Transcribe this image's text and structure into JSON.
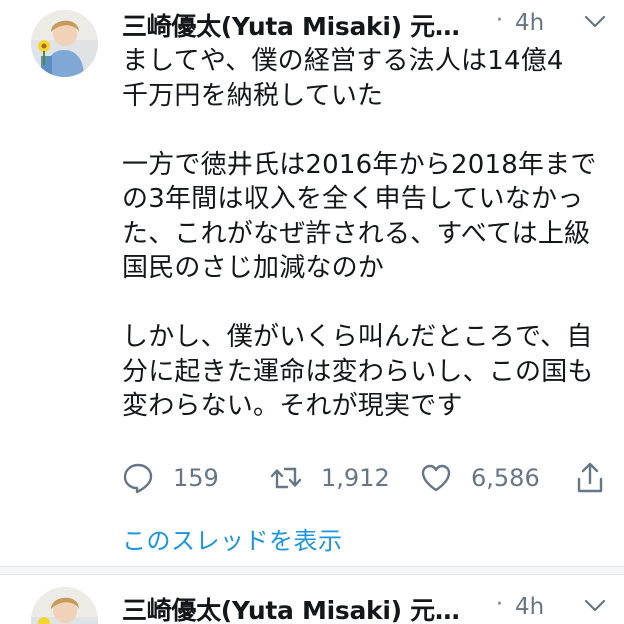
{
  "tweets": [
    {
      "author": "三崎優太(Yuta Misaki) 元…",
      "separator": "·",
      "time": "4h",
      "text": "ましてや、僕の経営する法人は14億4\n千万円を納税していた\n\n一方で徳井氏は2016年から2018年までの3年間は収入を全く申告していなかった、これがなぜ許される、すべては上級国民のさじ加減なのか\n\nしかし、僕がいくら叫んだところで、自分に起きた運命は変わらいし、この国も変わらない。それが現実です",
      "replies": "159",
      "retweets": "1,912",
      "likes": "6,586",
      "thread_link": "このスレッドを表示"
    },
    {
      "author": "三崎優太(Yuta Misaki) 元…",
      "separator": "·",
      "time": "4h"
    }
  ],
  "icons": {
    "reply": "speech-bubble-icon",
    "retweet": "retweet-arrows-icon",
    "like": "heart-icon",
    "share": "share-upload-icon",
    "menu": "chevron-down-icon"
  },
  "colors": {
    "text": "#14171a",
    "muted": "#657786",
    "link": "#1b95e0",
    "divider": "#f4f5f6"
  }
}
